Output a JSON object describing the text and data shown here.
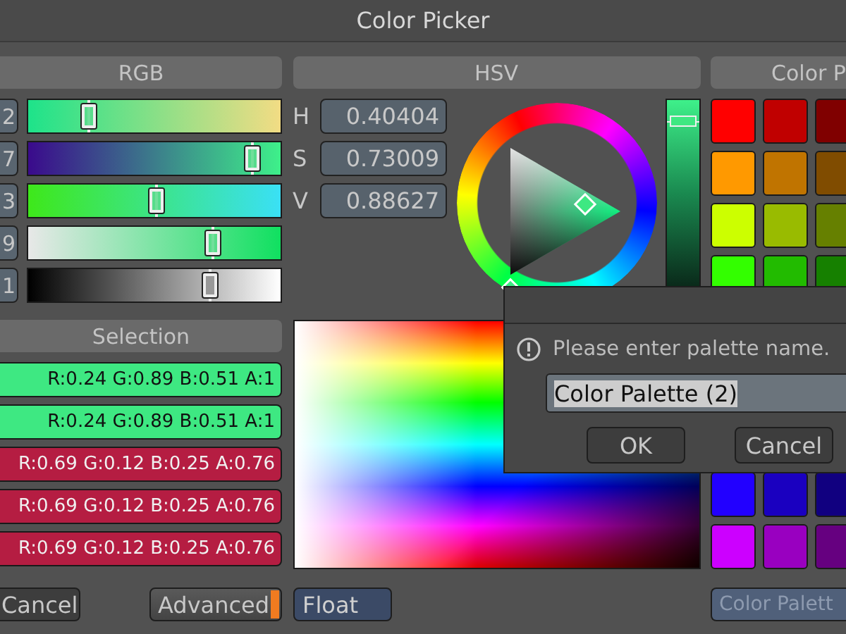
{
  "window": {
    "title": "Color Picker"
  },
  "rgb": {
    "title": "RGB",
    "sliders": [
      {
        "value": "2",
        "level": 0.24
      },
      {
        "value": "7",
        "level": 0.89
      },
      {
        "value": "3",
        "level": 0.51
      },
      {
        "value": "9",
        "level": 0.73
      },
      {
        "value": "1",
        "level": 0.72
      }
    ]
  },
  "hsv": {
    "title": "HSV",
    "fields": [
      {
        "label": "H",
        "value": "0.40404"
      },
      {
        "label": "S",
        "value": "0.73009"
      },
      {
        "label": "V",
        "value": "0.88627"
      }
    ],
    "value_bar": {
      "level": 0.89
    }
  },
  "palette": {
    "title": "Color P",
    "upper_swatches": [
      {
        "color": "#ff0000"
      },
      {
        "color": "#c00000"
      },
      {
        "color": "#800000"
      },
      {
        "color": "#ff9900"
      },
      {
        "color": "#c07400"
      },
      {
        "color": "#804c00"
      },
      {
        "color": "#ccff00"
      },
      {
        "color": "#99bb00"
      },
      {
        "color": "#668000"
      },
      {
        "color": "#33ff00"
      },
      {
        "color": "#22bb00"
      },
      {
        "color": "#168000"
      }
    ],
    "lower_swatches": [
      {
        "color": "#2200ff"
      },
      {
        "color": "#1a00c0"
      },
      {
        "color": "#110080"
      },
      {
        "color": "#cc00ff"
      },
      {
        "color": "#9900c0"
      },
      {
        "color": "#660080"
      }
    ]
  },
  "selection": {
    "title": "Selection",
    "rows": [
      {
        "text": "R:0.24 G:0.89 B:0.51 A:1",
        "color": "#3ee882"
      },
      {
        "text": "R:0.24 G:0.89 B:0.51 A:1",
        "color": "#3ee882"
      },
      {
        "text": "R:0.69 G:0.12 B:0.25 A:0.76",
        "color": "#b51d42"
      },
      {
        "text": "R:0.69 G:0.12 B:0.25 A:0.76",
        "color": "#b51d42"
      },
      {
        "text": "R:0.69 G:0.12 B:0.25 A:0.76",
        "color": "#b51d42"
      }
    ]
  },
  "buttons": {
    "cancel": "Cancel",
    "advanced": {
      "label": "Advanced",
      "on": true
    },
    "float": "Float",
    "color_palette": {
      "label": "Color Palett",
      "disabled": true
    }
  },
  "dialog": {
    "message": "Please enter palette name.",
    "input": {
      "value": "Color Palette (2)",
      "text_selected": true
    },
    "buttons": [
      "OK",
      "Cancel"
    ]
  }
}
